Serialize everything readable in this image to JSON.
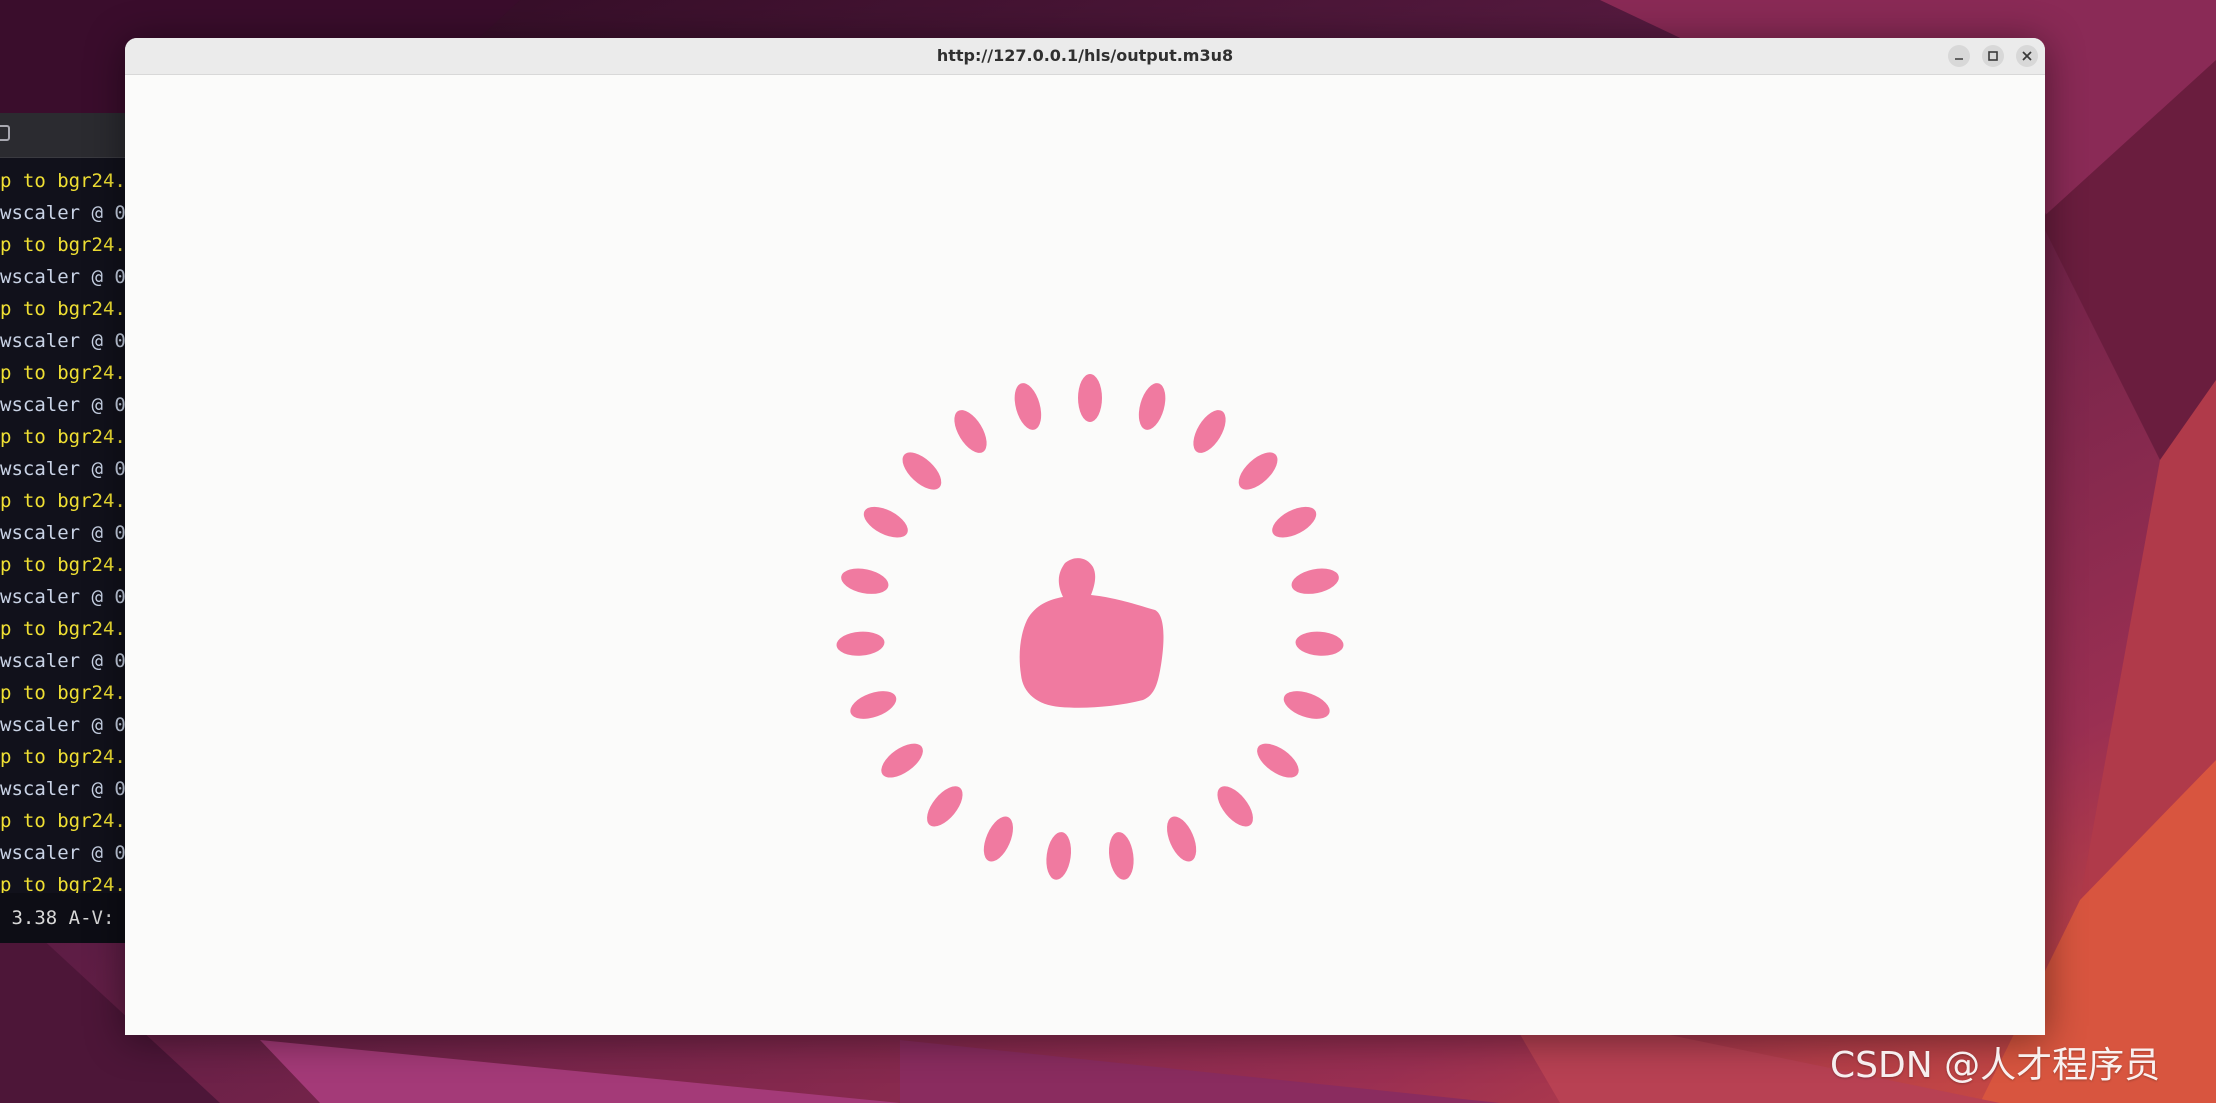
{
  "desktop": {
    "colors": {
      "wallpaper_dark": "#2a0a20",
      "wallpaper_purple": "#7c2a5a",
      "wallpaper_red": "#c8494a",
      "wallpaper_orange": "#e0583f"
    }
  },
  "terminal": {
    "lines": [
      {
        "text": "p to bgr24.",
        "color": "yellow"
      },
      {
        "text": "wscaler @ 0",
        "color": "white"
      },
      {
        "text": "p to bgr24.",
        "color": "yellow"
      },
      {
        "text": "wscaler @ 0",
        "color": "white"
      },
      {
        "text": "p to bgr24.",
        "color": "yellow"
      },
      {
        "text": "wscaler @ 0",
        "color": "white"
      },
      {
        "text": "p to bgr24.",
        "color": "yellow"
      },
      {
        "text": "wscaler @ 0",
        "color": "white"
      },
      {
        "text": "p to bgr24.",
        "color": "yellow"
      },
      {
        "text": "wscaler @ 0",
        "color": "white"
      },
      {
        "text": "p to bgr24.",
        "color": "yellow"
      },
      {
        "text": "wscaler @ 0",
        "color": "white"
      },
      {
        "text": "p to bgr24.",
        "color": "yellow"
      },
      {
        "text": "wscaler @ 0",
        "color": "white"
      },
      {
        "text": "p to bgr24.",
        "color": "yellow"
      },
      {
        "text": "wscaler @ 0",
        "color": "white"
      },
      {
        "text": "p to bgr24.",
        "color": "yellow"
      },
      {
        "text": "wscaler @ 0",
        "color": "white"
      },
      {
        "text": "p to bgr24.",
        "color": "yellow"
      },
      {
        "text": "wscaler @ 0",
        "color": "white"
      },
      {
        "text": "p to bgr24.",
        "color": "yellow"
      },
      {
        "text": "wscaler @ 0",
        "color": "white"
      },
      {
        "text": "p to bgr24.",
        "color": "yellow"
      }
    ],
    "status_text": " 3.38 A-V:"
  },
  "player": {
    "title": "http://127.0.0.1/hls/output.m3u8",
    "icons": {
      "minimize": "minimize-icon",
      "maximize": "maximize-icon",
      "close": "close-icon"
    },
    "video": {
      "content": "thumbs-up-icon",
      "accent_color": "#f07aa0",
      "background_color": "#fbfbfa"
    }
  },
  "watermark": {
    "text": "CSDN @人才程序员"
  }
}
